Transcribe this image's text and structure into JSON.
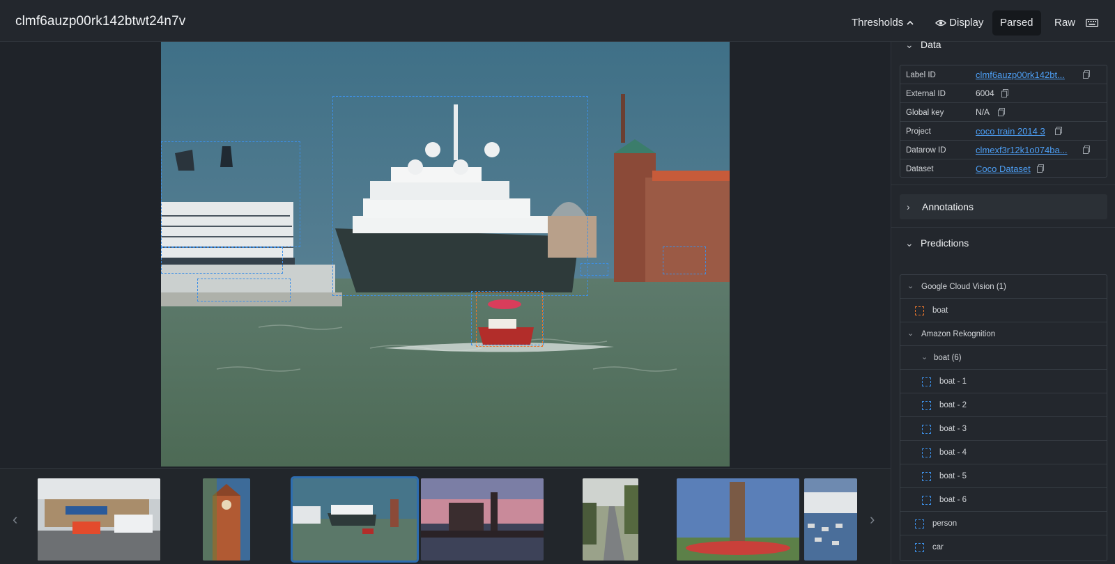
{
  "header": {
    "title": "clmf6auzp00rk142btwt24n7v",
    "thresholds_label": "Thresholds",
    "display_label": "Display",
    "parsed_label": "Parsed",
    "raw_label": "Raw"
  },
  "data_section": {
    "heading": "Data",
    "rows": [
      {
        "key": "Label ID",
        "value": "clmf6auzp00rk142bt..."
      },
      {
        "key": "External ID",
        "value": "6004"
      },
      {
        "key": "Global key",
        "value": "N/A"
      },
      {
        "key": "Project",
        "value": "coco train 2014 3"
      },
      {
        "key": "Datarow ID",
        "value": "clmexf3r12k1o074ba..."
      },
      {
        "key": "Dataset",
        "value": "Coco Dataset"
      }
    ]
  },
  "annotations_section": {
    "heading": "Annotations"
  },
  "predictions_section": {
    "heading": "Predictions",
    "groups": [
      {
        "name": "Google Cloud Vision (1)",
        "items": [
          "boat"
        ]
      },
      {
        "name": "Amazon Rekognition",
        "subgroup": "boat (6)",
        "items": [
          "boat - 1",
          "boat - 2",
          "boat - 3",
          "boat - 4",
          "boat - 5",
          "boat - 6",
          "person",
          "car"
        ]
      }
    ]
  },
  "colors": {
    "accent": "#3d8fe6",
    "orange_box": "#e8762d",
    "link": "#4d9ff5",
    "selected_outline": "#2e6db0"
  },
  "icons": [
    "chevron-up-icon",
    "eye-icon",
    "keyboard-icon",
    "copy-icon",
    "chevron-down-icon",
    "chevron-right-icon",
    "chevron-left-icon"
  ]
}
